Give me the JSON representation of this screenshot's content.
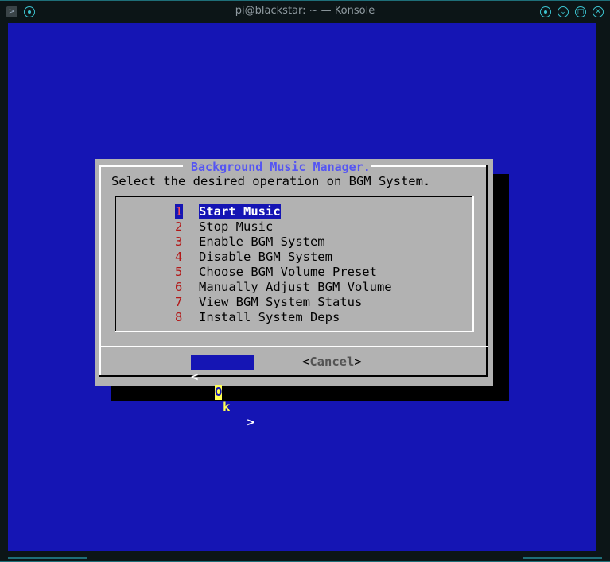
{
  "window": {
    "title": "pi@blackstar: ~ — Konsole"
  },
  "icons": {
    "app": "konsole-icon",
    "pin": "pin-icon",
    "menu": "window-menu-icon",
    "minimize": "minimize-icon",
    "maximize": "maximize-icon",
    "close": "close-icon"
  },
  "dialog": {
    "title": "Background Music Manager.",
    "prompt": "Select the desired operation on BGM System.",
    "items": [
      {
        "num": "1",
        "label": "Start Music",
        "selected": true
      },
      {
        "num": "2",
        "label": "Stop Music"
      },
      {
        "num": "3",
        "label": "Enable BGM System"
      },
      {
        "num": "4",
        "label": "Disable BGM System"
      },
      {
        "num": "5",
        "label": "Choose BGM Volume Preset"
      },
      {
        "num": "6",
        "label": "Manually Adjust BGM Volume"
      },
      {
        "num": "7",
        "label": "View BGM System Status"
      },
      {
        "num": "8",
        "label": "Install System Deps"
      }
    ],
    "ok": {
      "left": "<",
      "hotkey": "O",
      "rest": "k",
      "right": ">"
    },
    "cancel": {
      "left": "<",
      "label": "Cancel",
      "right": ">"
    }
  },
  "colors": {
    "terminal_bg": "#1515b4",
    "dialog_bg": "#b2b2b2",
    "title_fg": "#5656f2",
    "number_fg": "#b21818",
    "hotkey_bg": "#ffff54",
    "accent": "#3cc3cf"
  }
}
